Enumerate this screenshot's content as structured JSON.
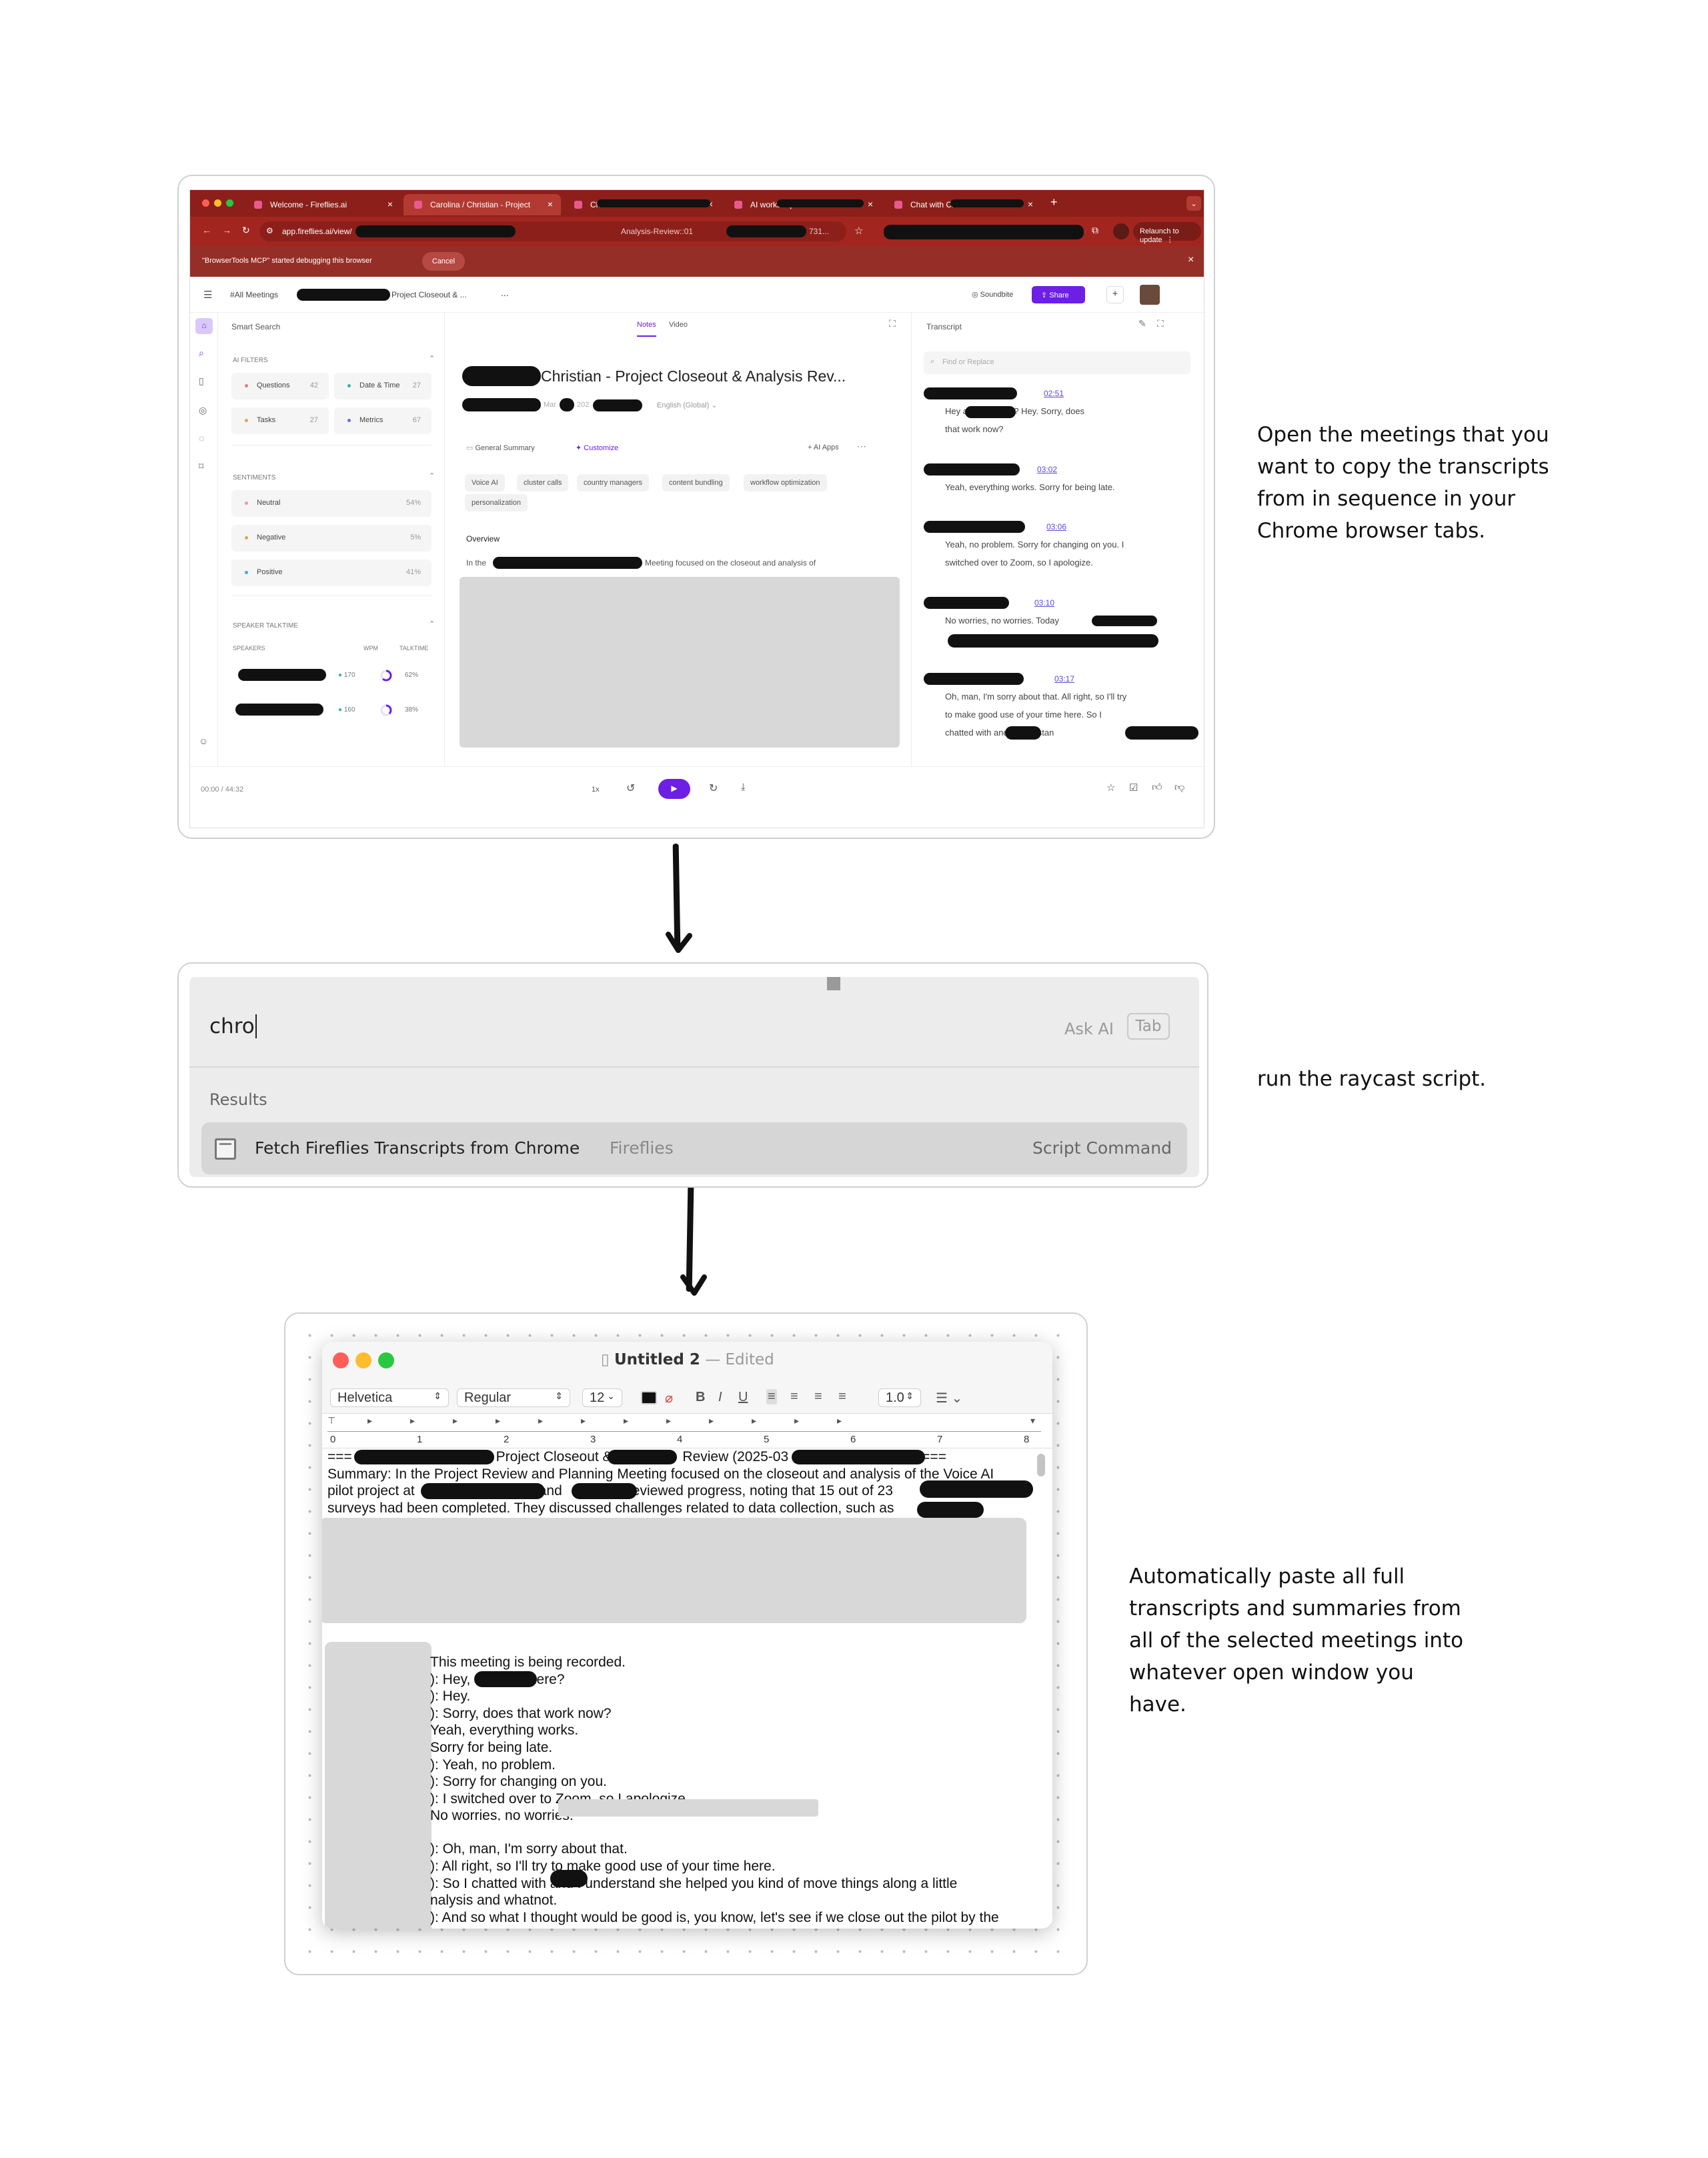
{
  "step1": {
    "caption": [
      "Open the meetings that you",
      "want to copy the transcripts",
      "from in sequence in your",
      "Chrome browser tabs."
    ],
    "tabs": [
      {
        "label": "Welcome - Fireflies.ai"
      },
      {
        "label": "Carolina / Christian - Project"
      },
      {
        "label": "Christian"
      },
      {
        "label": "AI workshop:"
      },
      {
        "label": "Chat with Christian"
      }
    ],
    "url": {
      "host": "app.fireflies.ai/view/",
      "middle": "Analysis-Review::01",
      "tail": "731..."
    },
    "relaunch": "Relaunch to update",
    "debug": {
      "message": "\"BrowserTools MCP\" started debugging this browser",
      "cancel": "Cancel"
    },
    "app": {
      "breadcrumb_all": "#All Meetings",
      "breadcrumb_title": "Project Closeout & ...",
      "more": "...",
      "soundbite": "Soundbite",
      "share": "Share"
    },
    "left": {
      "smart_search": "Smart Search",
      "ai_filters": "AI FILTERS",
      "filters": [
        {
          "label": "Questions",
          "count": "42",
          "color": "#e8758c"
        },
        {
          "label": "Date & Time",
          "count": "27",
          "color": "#39b3a5"
        },
        {
          "label": "Tasks",
          "count": "27",
          "color": "#e8a24a"
        },
        {
          "label": "Metrics",
          "count": "67",
          "color": "#6c6cd9"
        }
      ],
      "sentiments_title": "SENTIMENTS",
      "sentiments": [
        {
          "label": "Neutral",
          "pct": "54%",
          "color": "#e89aa2"
        },
        {
          "label": "Negative",
          "pct": "5%",
          "color": "#e8a24a"
        },
        {
          "label": "Positive",
          "pct": "41%",
          "color": "#4aa8d8"
        }
      ],
      "talktime_title": "SPEAKER TALKTIME",
      "speakers_header": "SPEAKERS",
      "wpm_header": "WPM",
      "talktime_header": "TALKTIME",
      "speakers": [
        {
          "wpm": "170",
          "talk": "62%",
          "fraction": 0.62
        },
        {
          "wpm": "160",
          "talk": "38%",
          "fraction": 0.38
        }
      ]
    },
    "notes": {
      "tab_notes": "Notes",
      "tab_video": "Video",
      "title": "Christian - Project Closeout & Analysis Rev...",
      "meta_date": "Mar",
      "meta_year": "202",
      "language": "English (Global)",
      "general_summary": "General Summary",
      "customize": "Customize",
      "ai_apps": "AI Apps",
      "keywords": [
        "Voice AI",
        "cluster calls",
        "country managers",
        "content bundling",
        "workflow optimization",
        "personalization"
      ],
      "overview": "Overview",
      "overview_start": "In the",
      "overview_rest": "Meeting focused on the closeout and analysis of"
    },
    "transcript": {
      "title": "Transcript",
      "find_placeholder": "Find or Replace",
      "entries": [
        {
          "time": "02:51",
          "lines": [
            "Hey           are you there? Hey. Sorry, does",
            "that work now?"
          ]
        },
        {
          "time": "03:02",
          "lines": [
            "Yeah, everything works. Sorry for being late."
          ]
        },
        {
          "time": "03:06",
          "lines": [
            "Yeah, no problem. Sorry for changing on you. I",
            "switched over to Zoom, so I apologize."
          ]
        },
        {
          "time": "03:10",
          "lines": [
            "No worries, no worries. Today"
          ]
        },
        {
          "time": "03:17",
          "lines": [
            "Oh, man, I'm sorry about that. All right, so I'll try",
            "to make good use of your time here. So I",
            "chatted with         and I understan"
          ]
        }
      ]
    },
    "player": {
      "time": "00:00 / 44:32",
      "speed": "1x"
    }
  },
  "step2": {
    "caption": "run the raycast script.",
    "query": "chro",
    "ask_ai": "Ask AI",
    "tab_key": "Tab",
    "results_label": "Results",
    "result": {
      "title": "Fetch Fireflies Transcripts from Chrome",
      "subtitle": "Fireflies",
      "type": "Script Command"
    }
  },
  "step3": {
    "caption": [
      "Automatically paste all full",
      "transcripts and summaries from",
      "all of the selected meetings into",
      "whatever open window you",
      "have."
    ],
    "window_title": "Untitled 2",
    "edited": "Edited",
    "toolbar": {
      "font": "Helvetica",
      "style": "Regular",
      "size": "12",
      "bold": "B",
      "italic": "I",
      "underline": "U",
      "spacing": "1.0"
    },
    "ruler_numbers": [
      "0",
      "1",
      "2",
      "3",
      "4",
      "5",
      "6",
      "7",
      "8"
    ],
    "doc_top": [
      {
        "a": "=== ",
        "b": "Project Closeout & ",
        "c": "Review (2025-03",
        "d": "==="
      },
      {
        "text": "Summary: In the Project Review and Planning Meeting focused on the closeout and analysis of the Voice AI"
      },
      {
        "a": "pilot project at",
        "b": "and",
        "c": "reviewed progress, noting that 15 out of 23"
      },
      {
        "text": "surveys had been completed. They discussed challenges related to data collection, such as"
      }
    ],
    "doc_lines": [
      "This meeting is being recorded.",
      "): Hey,            are you there?",
      "): Hey.",
      "): Sorry, does that work now?",
      "Yeah, everything works.",
      "Sorry for being late.",
      "): Yeah, no problem.",
      "): Sorry for changing on you.",
      "): I switched over to Zoom, so I apologize.",
      "No worries, no worries.",
      "",
      "): Oh, man, I'm sorry about that.",
      "): All right, so I'll try to make good use of your time here.",
      "): So I chatted with          and I understand she helped you kind of move things along a little",
      "nalysis and whatnot.",
      "): And so what I thought would be good is, you know, let's see if we close out the pilot by the"
    ]
  }
}
